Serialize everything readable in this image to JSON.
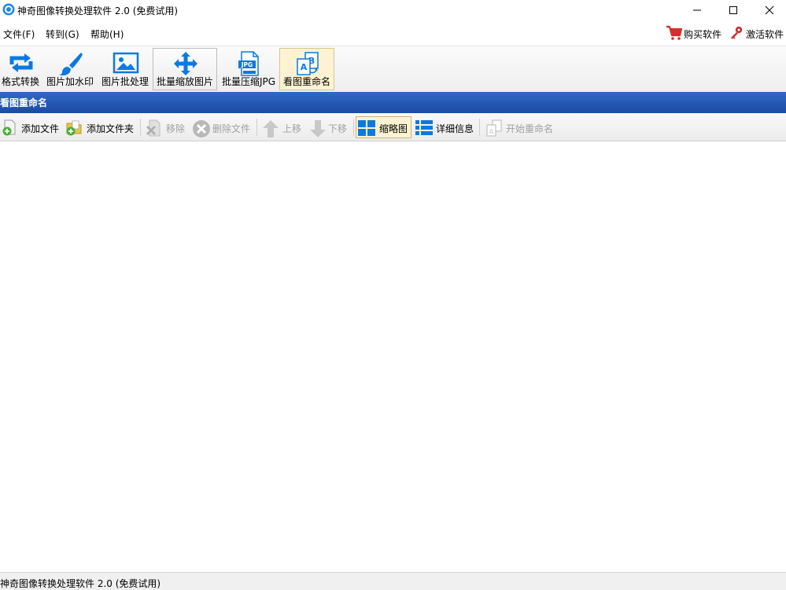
{
  "window": {
    "title": "神奇图像转换处理软件 2.0 (免费试用)"
  },
  "menu": {
    "items": [
      "文件(F)",
      "转到(G)",
      "帮助(H)"
    ],
    "buy_label": "购买软件",
    "activate_label": "激活软件"
  },
  "toolbar": {
    "tools": [
      {
        "label": "格式转换",
        "icon": "convert-icon"
      },
      {
        "label": "图片加水印",
        "icon": "brush-icon"
      },
      {
        "label": "图片批处理",
        "icon": "image-icon"
      },
      {
        "label": "批量缩放图片",
        "icon": "move-arrows-icon"
      },
      {
        "label": "批量压缩JPG",
        "icon": "jpg-file-icon"
      },
      {
        "label": "看图重命名",
        "icon": "rename-icon"
      }
    ],
    "active_tool": "看图重命名"
  },
  "section": {
    "title": "看图重命名"
  },
  "subtoolbar": {
    "add_file": "添加文件",
    "add_folder": "添加文件夹",
    "remove": "移除",
    "delete_file": "删除文件",
    "move_up": "上移",
    "move_down": "下移",
    "thumbnail": "缩略图",
    "details": "详细信息",
    "start_rename": "开始重命名"
  },
  "status": {
    "text": "神奇图像转换处理软件 2.0 (免费试用)"
  },
  "colors": {
    "accent_blue": "#0a7ae0",
    "header_blue": "#1f55b3",
    "active_bg": "#fdf3d2"
  }
}
